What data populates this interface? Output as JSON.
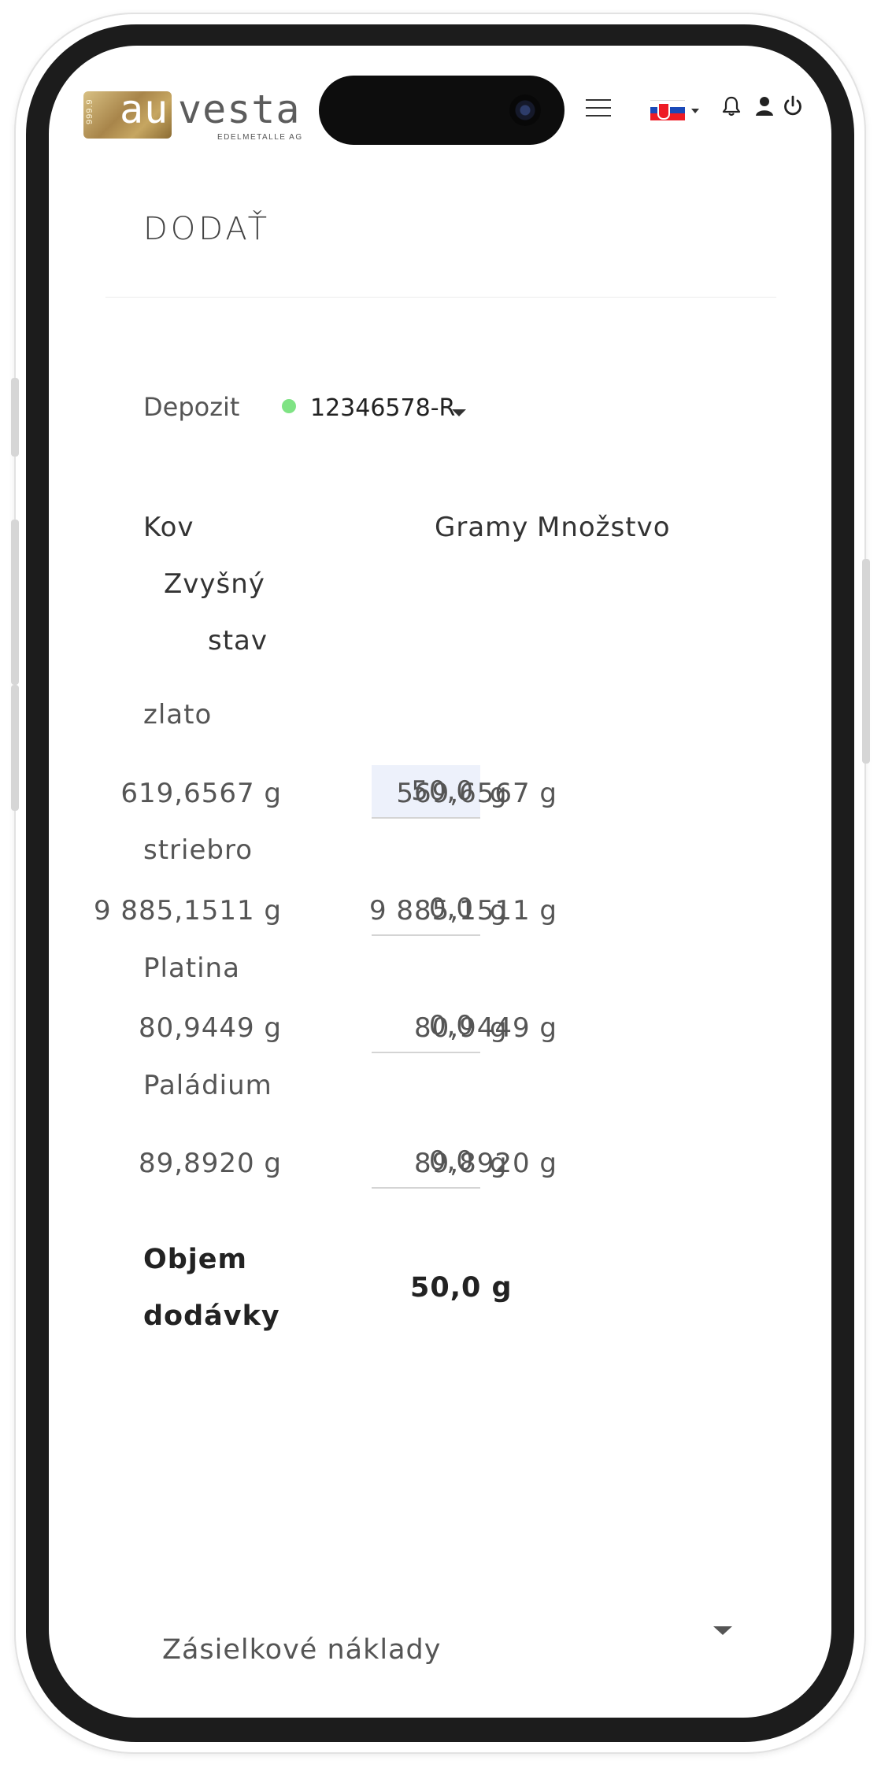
{
  "header": {
    "logo_gold_text": "999.9",
    "logo_au": "au",
    "logo_vesta": "vesta",
    "logo_sub": "EDELMETALLE AG"
  },
  "page": {
    "title": "DODAŤ"
  },
  "deposit": {
    "label": "Depozit",
    "value": "12346578-R",
    "status_color": "#7fe384"
  },
  "table": {
    "headers": {
      "metal": "Kov",
      "grams": "Gramy",
      "quantity": "Množstvo",
      "remaining_1": "Zvyšný",
      "remaining_2": "stav"
    },
    "rows": [
      {
        "metal": "zlato",
        "balance": "619,6567 g",
        "qty": "50,0",
        "unit": "g",
        "remaining": "569,6567 g"
      },
      {
        "metal": "striebro",
        "balance": "9 885,1511 g",
        "qty": "0,0",
        "unit": "g",
        "remaining": "9 885,1511 g"
      },
      {
        "metal": "Platina",
        "balance": "80,9449 g",
        "qty": "0,0",
        "unit": "g",
        "remaining": "80,9449 g"
      },
      {
        "metal": "Paládium",
        "balance": "89,8920 g",
        "qty": "0,0",
        "unit": "g",
        "remaining": "89,8920 g"
      }
    ]
  },
  "summary": {
    "label_1": "Objem",
    "label_2": "dodávky",
    "value": "50,0 g"
  },
  "shipping": {
    "label": "Zásielkové náklady"
  },
  "icons": [
    "menu-icon",
    "slovak-flag-icon",
    "bell-icon",
    "user-icon",
    "power-icon"
  ]
}
